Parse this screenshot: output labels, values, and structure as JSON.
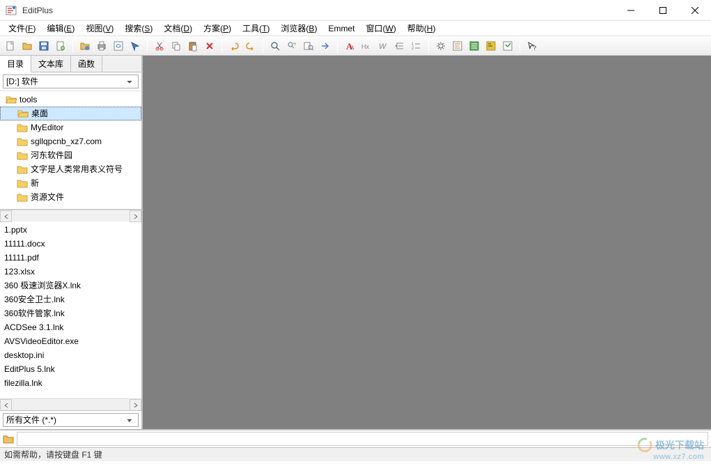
{
  "title": "EditPlus",
  "menu": [
    {
      "label": "文件",
      "key": "F"
    },
    {
      "label": "编辑",
      "key": "E"
    },
    {
      "label": "视图",
      "key": "V"
    },
    {
      "label": "搜索",
      "key": "S"
    },
    {
      "label": "文档",
      "key": "D"
    },
    {
      "label": "方案",
      "key": "P"
    },
    {
      "label": "工具",
      "key": "T"
    },
    {
      "label": "浏览器",
      "key": "B"
    },
    {
      "label": "Emmet",
      "key": ""
    },
    {
      "label": "窗口",
      "key": "W"
    },
    {
      "label": "帮助",
      "key": "H"
    }
  ],
  "sidebar": {
    "tabs": [
      "目录",
      "文本库",
      "函数"
    ],
    "active_tab": 0,
    "drive": "[D:] 软件",
    "folders": [
      {
        "name": "tools",
        "depth": 0,
        "open": true,
        "selected": false
      },
      {
        "name": "桌面",
        "depth": 1,
        "open": true,
        "selected": true
      },
      {
        "name": "MyEditor",
        "depth": 2,
        "open": false,
        "selected": false
      },
      {
        "name": "sgllqpcnb_xz7.com",
        "depth": 2,
        "open": false,
        "selected": false
      },
      {
        "name": "河东软件园",
        "depth": 2,
        "open": false,
        "selected": false
      },
      {
        "name": "文字是人类常用表义符号",
        "depth": 2,
        "open": false,
        "selected": false
      },
      {
        "name": "新",
        "depth": 2,
        "open": false,
        "selected": false
      },
      {
        "name": "资源文件",
        "depth": 2,
        "open": false,
        "selected": false
      }
    ],
    "files": [
      "1.pptx",
      "11111.docx",
      "11111.pdf",
      "123.xlsx",
      "360 极速浏览器X.lnk",
      "360安全卫士.lnk",
      "360软件管家.lnk",
      "ACDSee 3.1.lnk",
      "AVSVideoEditor.exe",
      "desktop.ini",
      "EditPlus 5.lnk",
      "filezilla.lnk"
    ],
    "filter": "所有文件 (*.*)"
  },
  "pathbar": {
    "path": ""
  },
  "status": "如需帮助，请按键盘 F1 键",
  "watermark": {
    "brand": "极光下载站",
    "url": "www.xz7.com"
  }
}
